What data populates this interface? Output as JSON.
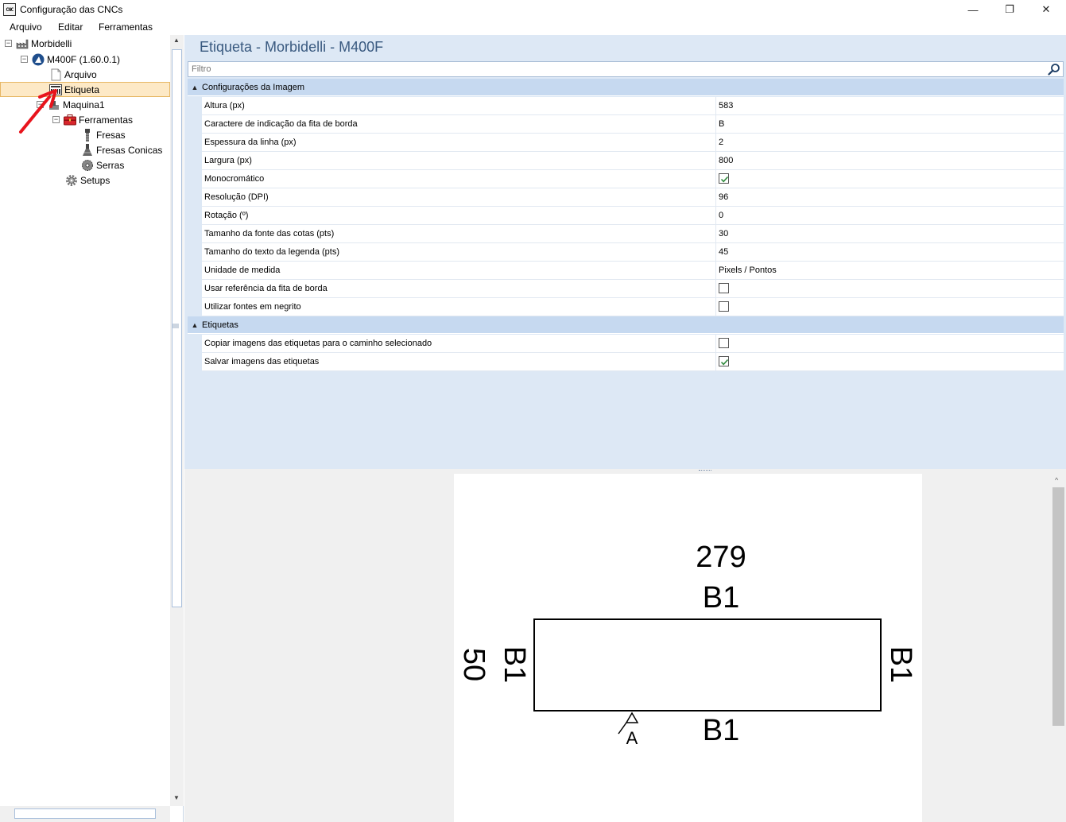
{
  "window": {
    "title": "Configuração das CNCs",
    "icon_text": "CNC",
    "controls": {
      "minimize": "—",
      "maximize": "❐",
      "close": "✕"
    }
  },
  "menu": {
    "items": [
      "Arquivo",
      "Editar",
      "Ferramentas"
    ]
  },
  "tree": {
    "items": [
      {
        "label": "Morbidelli",
        "icon": "factory-icon",
        "expander": "⊟"
      },
      {
        "label": "M400F (1.60.0.1)",
        "icon": "machine-logo-icon",
        "expander": "⊟"
      },
      {
        "label": "Arquivo",
        "icon": "document-icon"
      },
      {
        "label": "Etiqueta",
        "icon": "label-icon",
        "selected": true
      },
      {
        "label": "Maquina1",
        "icon": "machine-icon",
        "expander": "⊟"
      },
      {
        "label": "Ferramentas",
        "icon": "toolbox-icon",
        "expander": "⊟"
      },
      {
        "label": "Fresas",
        "icon": "drill-bit-icon"
      },
      {
        "label": "Fresas Conicas",
        "icon": "conical-bit-icon"
      },
      {
        "label": "Serras",
        "icon": "saw-blade-icon"
      },
      {
        "label": "Setups",
        "icon": "gear-icon"
      }
    ]
  },
  "panel": {
    "title": "Etiqueta - Morbidelli - M400F",
    "filter_placeholder": "Filtro"
  },
  "sections": [
    {
      "name": "Configurações da Imagem",
      "rows": [
        {
          "label": "Altura (px)",
          "value": "583"
        },
        {
          "label": "Caractere de indicação da fita de borda",
          "value": "B"
        },
        {
          "label": "Espessura da linha (px)",
          "value": "2"
        },
        {
          "label": "Largura (px)",
          "value": "800"
        },
        {
          "label": "Monocromático",
          "checked": true
        },
        {
          "label": "Resolução (DPI)",
          "value": "96"
        },
        {
          "label": "Rotação (º)",
          "value": "0"
        },
        {
          "label": "Tamanho da fonte das cotas (pts)",
          "value": "30"
        },
        {
          "label": "Tamanho do texto da legenda (pts)",
          "value": "45"
        },
        {
          "label": "Unidade de medida",
          "value": "Pixels / Pontos"
        },
        {
          "label": "Usar referência da fita de borda",
          "checked": false
        },
        {
          "label": "Utilizar fontes em negrito",
          "checked": false
        }
      ]
    },
    {
      "name": "Etiquetas",
      "rows": [
        {
          "label": "Copiar imagens das etiquetas para o caminho selecionado",
          "checked": false
        },
        {
          "label": "Salvar imagens das etiquetas",
          "checked": true
        }
      ]
    }
  ],
  "preview": {
    "width_dimension": "279",
    "height_dimension": "50",
    "edge_top": "B1",
    "edge_bottom": "B1",
    "edge_left": "B1",
    "edge_right": "B1",
    "grain_marker": "A"
  },
  "colors": {
    "accent": "#3a5a80",
    "selection": "#fde9c6",
    "section_header": "#c6d9f0",
    "annotation_arrow": "#e8141c",
    "check": "#2f8a3c"
  }
}
